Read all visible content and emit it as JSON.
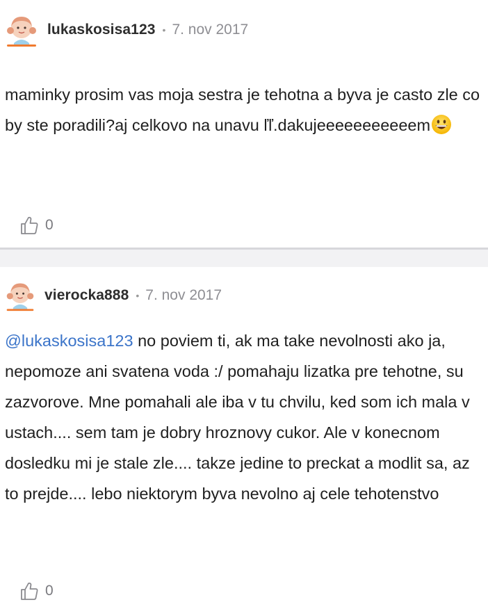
{
  "posts": [
    {
      "username": "lukaskosisa123",
      "separator_dot": "•",
      "date": "7. nov 2017",
      "text": "maminky prosim vas moja sestra je tehotna a byva je casto zle co by ste poradili?aj celkovo na unavu ľľ.dakujeeeeeeeeeeem",
      "emoji": "grinning-face-emoji",
      "likes": "0",
      "like_icon": "thumbs-up-icon",
      "avatar_icon": "girl-avatar-icon"
    },
    {
      "username": "vierocka888",
      "separator_dot": "•",
      "date": "7. nov 2017",
      "mention": "@lukaskosisa123",
      "text": " no poviem ti, ak ma take nevolnosti ako ja, nepomoze ani svatena voda :/ pomahaju lizatka pre tehotne, su zazvorove. Mne pomahali ale iba v tu chvilu, ked som ich mala v ustach.... sem tam je dobry hroznovy cukor. Ale v konecnom dosledku mi je stale zle.... takze jedine to preckat a modlit sa, az to prejde.... lebo niektorym byva nevolno aj cele tehotenstvo",
      "likes": "0",
      "like_icon": "thumbs-up-icon",
      "avatar_icon": "girl-avatar-icon"
    }
  ],
  "colors": {
    "mention": "#3b74c9",
    "separator_bg": "#f2f2f4",
    "separator_line": "#d7d7db",
    "avatar_accent": "#f07a2e"
  }
}
